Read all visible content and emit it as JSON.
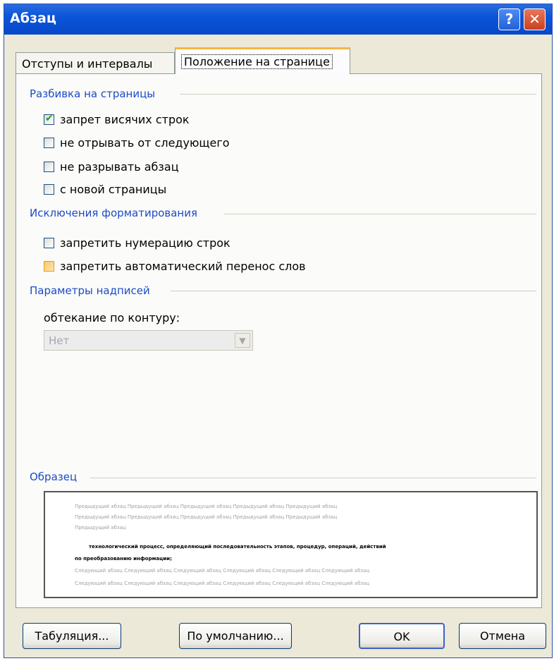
{
  "window": {
    "title": "Абзац"
  },
  "titlebar": {
    "help_glyph": "?",
    "close_glyph": "✕"
  },
  "tabs": [
    {
      "label": "Отступы и интервалы",
      "active": false
    },
    {
      "label": "Положение на странице",
      "active": true
    }
  ],
  "pagination": {
    "header": "Разбивка на страницы",
    "options": [
      {
        "label": "запрет висячих строк",
        "checked": true
      },
      {
        "label": "не отрывать от следующего",
        "checked": false
      },
      {
        "label": "не разрывать абзац",
        "checked": false
      },
      {
        "label": "с новой страницы",
        "checked": false
      }
    ]
  },
  "formatting_exceptions": {
    "header": "Исключения форматирования",
    "options": [
      {
        "label": "запретить нумерацию строк",
        "checked": false
      },
      {
        "label": "запретить автоматический перенос слов",
        "checked": false
      }
    ]
  },
  "textbox_options": {
    "header": "Параметры надписей",
    "wrap_label": "обтекание по контуру:",
    "wrap_value": "Нет"
  },
  "preview": {
    "header": "Образец",
    "prev_line1": "Предыдущий абзац Предыдущий абзац Предыдущий абзац Предыдущий абзац Предыдущий абзац",
    "prev_line2": "Предыдущий абзац Предыдущий абзац Предыдущий абзац Предыдущий абзац Предыдущий абзац",
    "prev_line3": "Предыдущий абзац",
    "main_line1": "технологический процесс, определяющий последовательность этапов, процедур, операций, действий",
    "main_line2": "по преобразованию информации;",
    "next_line1": "Следующий абзац Следующий абзац Следующий абзац Следующий абзац Следующий абзац Следующий абзац",
    "next_line2": "Следующий абзац Следующий абзац Следующий абзац Следующий абзац Следующий абзац Следующий абзац"
  },
  "buttons": {
    "tabs": "Табуляция...",
    "default": "По умолчанию...",
    "ok": "OK",
    "cancel": "Отмена"
  }
}
